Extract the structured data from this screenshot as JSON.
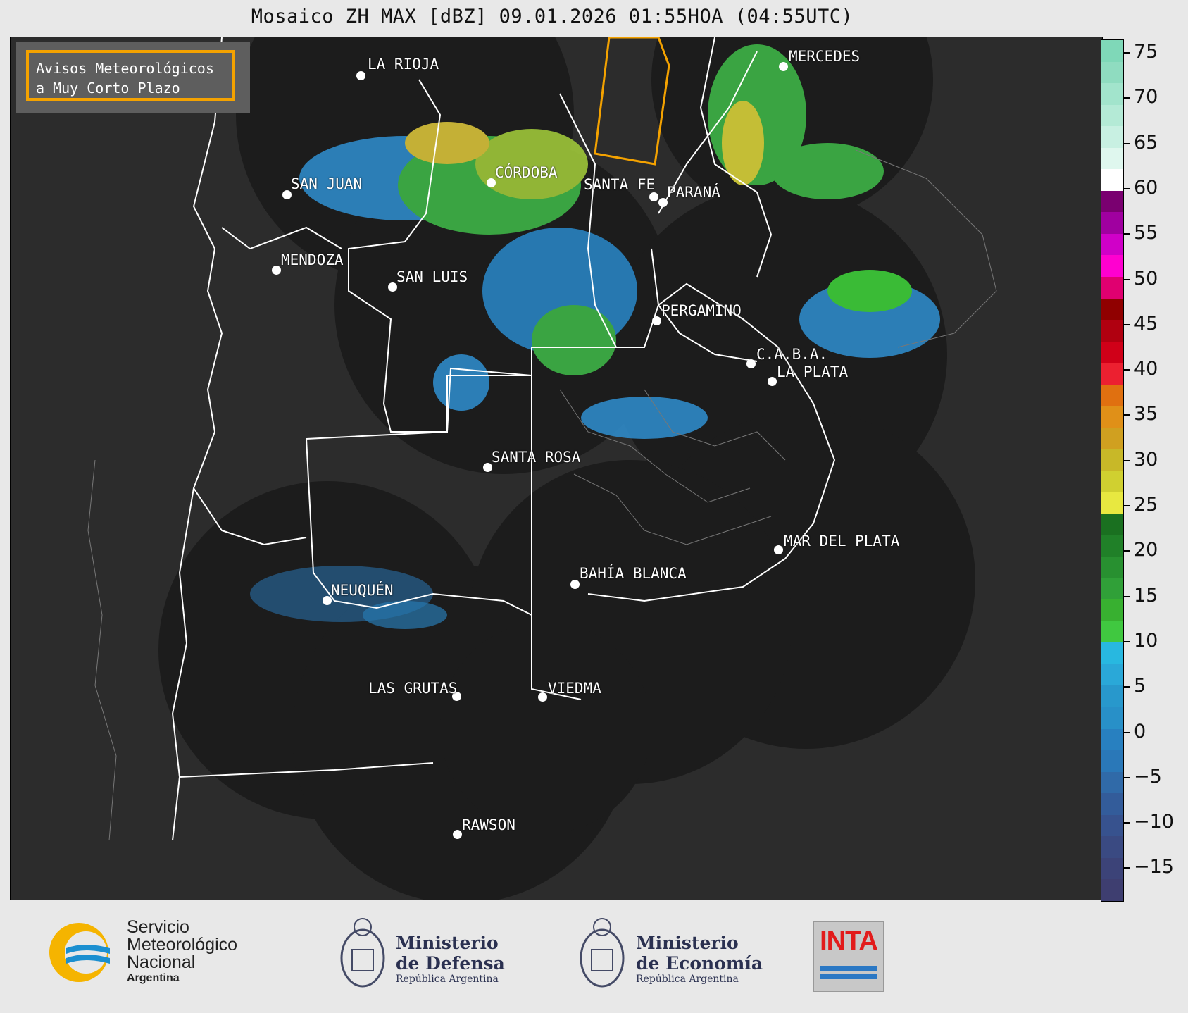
{
  "title": "Mosaico ZH MAX [dBZ] 09.01.2026 01:55HOA (04:55UTC)",
  "warning_box": {
    "line1": "Avisos Meteorológicos",
    "line2": "a Muy Corto Plazo"
  },
  "cities": [
    {
      "name": "LA RIOJA"
    },
    {
      "name": "CÓRDOBA"
    },
    {
      "name": "SAN JUAN"
    },
    {
      "name": "SANTA FE"
    },
    {
      "name": "PARANÁ"
    },
    {
      "name": "MERCEDES"
    },
    {
      "name": "MENDOZA"
    },
    {
      "name": "SAN LUIS"
    },
    {
      "name": "PERGAMINO"
    },
    {
      "name": "C.A.B.A."
    },
    {
      "name": "LA PLATA"
    },
    {
      "name": "SANTA ROSA"
    },
    {
      "name": "MAR DEL PLATA"
    },
    {
      "name": "BAHÍA BLANCA"
    },
    {
      "name": "NEUQUÉN"
    },
    {
      "name": "LAS GRUTAS"
    },
    {
      "name": "VIEDMA"
    },
    {
      "name": "RAWSON"
    }
  ],
  "colorbar": {
    "ticks": [
      "75",
      "70",
      "65",
      "60",
      "55",
      "50",
      "45",
      "40",
      "35",
      "30",
      "25",
      "20",
      "15",
      "10",
      "5",
      "0",
      "−5",
      "−10",
      "−15"
    ],
    "colors_top_to_bottom": [
      "#7fd8b8",
      "#8fdcc0",
      "#a2e4cc",
      "#b4ead6",
      "#c8f0e2",
      "#dff7ee",
      "#ffffff",
      "#7a0070",
      "#a000a0",
      "#d000c8",
      "#ff00d0",
      "#e00070",
      "#900000",
      "#b00010",
      "#d00018",
      "#ec2030",
      "#e07010",
      "#e09018",
      "#d0a020",
      "#c8b828",
      "#d0d030",
      "#e8e840",
      "#1a7020",
      "#208028",
      "#289030",
      "#30a038",
      "#38b030",
      "#40c840",
      "#28b8e0",
      "#2aa8d8",
      "#2898cc",
      "#2890c8",
      "#2880c0",
      "#2a78b8",
      "#306aa8",
      "#335c9a",
      "#37528e",
      "#3a4a82",
      "#3c4378",
      "#3e3e70"
    ]
  },
  "logos": {
    "smn_line1": "Servicio",
    "smn_line2": "Meteorológico",
    "smn_line3": "Nacional",
    "smn_line4": "Argentina",
    "defensa_line1": "Ministerio",
    "defensa_line2": "de Defensa",
    "defensa_line3": "República Argentina",
    "economia_line1": "Ministerio",
    "economia_line2": "de Economía",
    "economia_line3": "República Argentina",
    "inta": "INTA"
  }
}
